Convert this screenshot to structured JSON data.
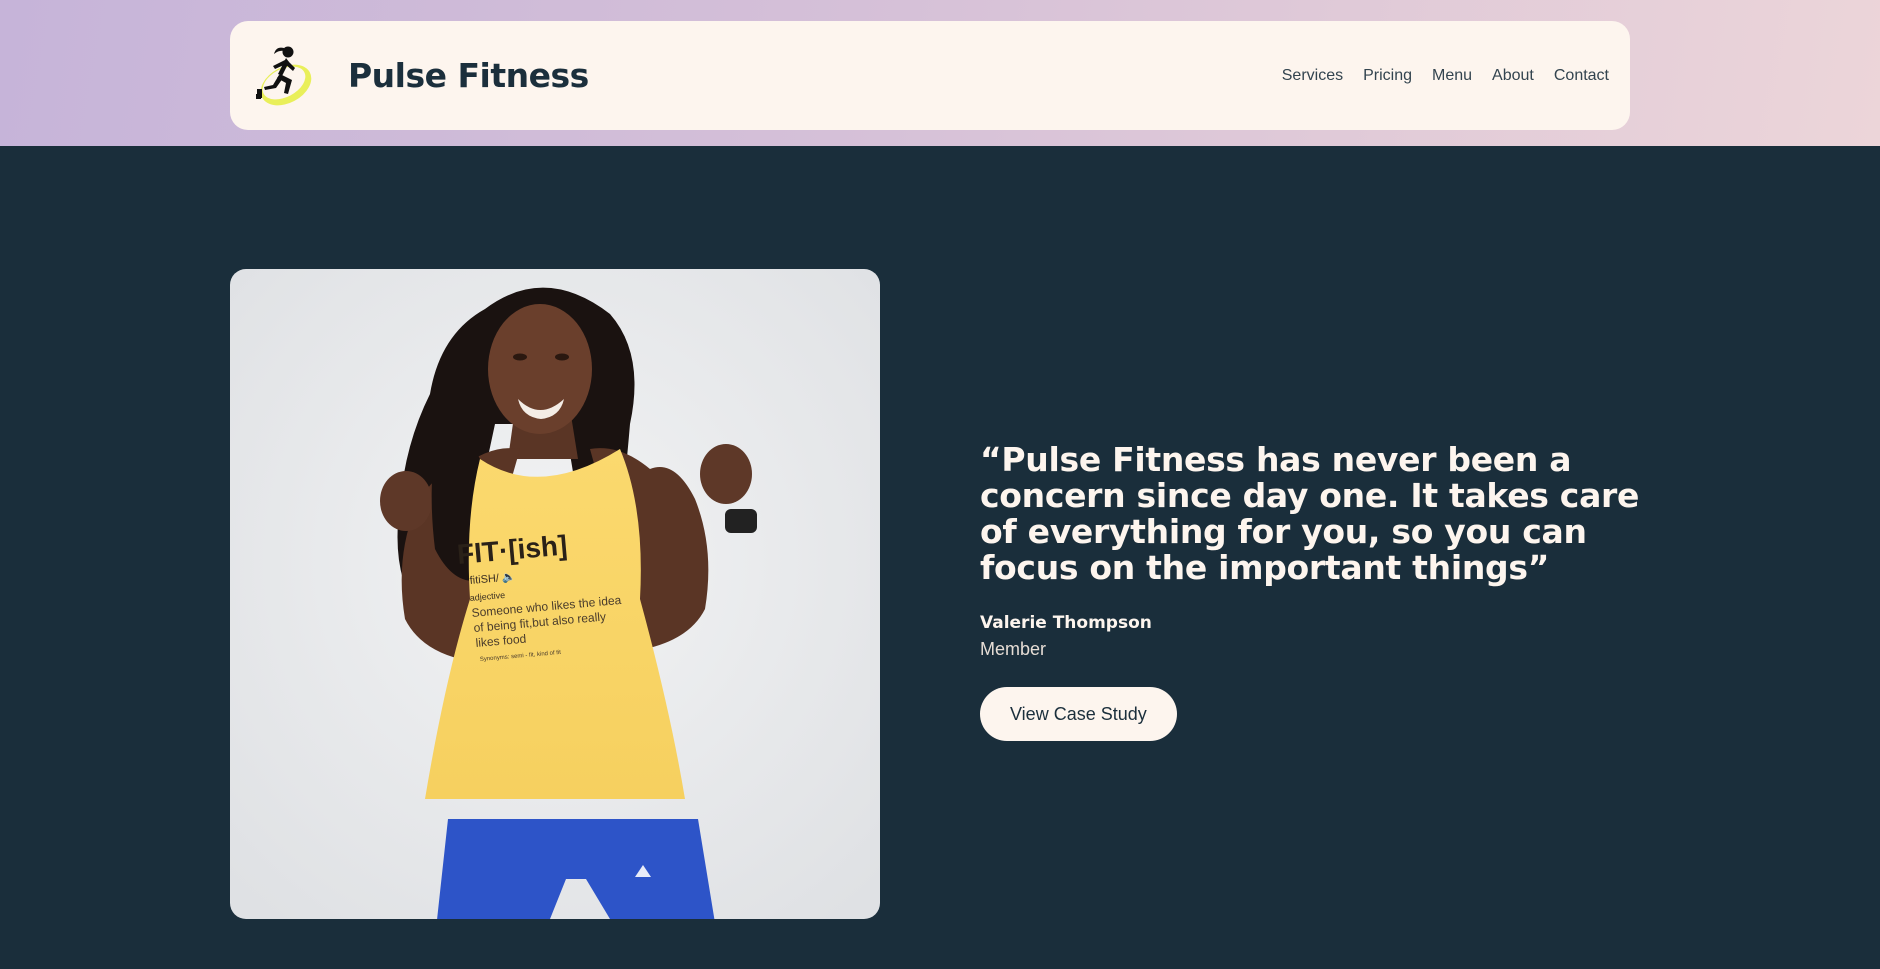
{
  "header": {
    "brand_name": "Pulse Fitness",
    "nav": [
      "Services",
      "Pricing",
      "Menu",
      "About",
      "Contact"
    ]
  },
  "testimonial": {
    "quote": "“Pulse Fitness has never been a concern since day one. It takes care of everything for you, so you can focus on the important things”",
    "author_name": "Valerie Thompson",
    "author_role": "Member",
    "cta_label": "View Case Study"
  },
  "photo": {
    "shirt_text_1": "FIT·[ish]",
    "shirt_text_2": "fitiSH/ 🔈",
    "shirt_text_3": "adjective",
    "shirt_text_4": "Someone who likes the idea",
    "shirt_text_5": "of being fit,but also really",
    "shirt_text_6": "likes food",
    "shirt_text_7": "Synonyms: semi - fit, kind of fit"
  },
  "colors": {
    "background": "#1a2e3b",
    "navbar": "#fdf5ee",
    "accent_yellow": "#e9ef5a",
    "top_band_start": "#c6b4d9",
    "top_band_end": "#ecd5d9",
    "shirt": "#fbd86b",
    "shorts": "#2d54c8"
  },
  "icons": {
    "logo": "running-woman-logo"
  }
}
